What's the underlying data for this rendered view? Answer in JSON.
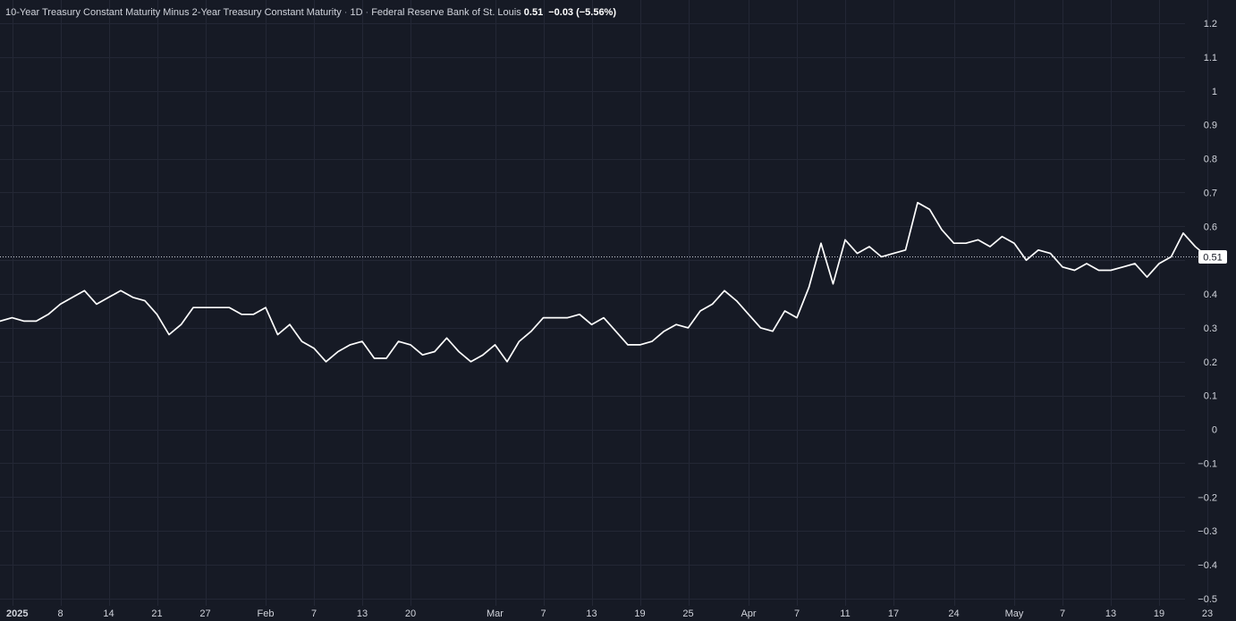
{
  "legend": {
    "title": "10-Year Treasury Constant Maturity Minus 2-Year Treasury Constant Maturity",
    "interval": "1D",
    "source": "Federal Reserve Bank of St. Louis",
    "separator": "·",
    "last_value": "0.51",
    "change": "−0.03",
    "change_percent": "(−5.56%)"
  },
  "colors": {
    "background": "#161a25",
    "grid": "#232735",
    "line": "#ffffff",
    "text": "#d1d4dc",
    "price_tag_bg": "#ffffff",
    "price_tag_text": "#131722"
  },
  "chart_data": {
    "type": "line",
    "series": [
      {
        "values": [
          0.32,
          0.33,
          0.32,
          0.32,
          0.34,
          0.37,
          0.39,
          0.41,
          0.37,
          0.39,
          0.41,
          0.39,
          0.38,
          0.34,
          0.28,
          0.31,
          0.36,
          0.36,
          0.36,
          0.36,
          0.34,
          0.34,
          0.36,
          0.28,
          0.31,
          0.26,
          0.24,
          0.2,
          0.23,
          0.25,
          0.26,
          0.21,
          0.21,
          0.26,
          0.25,
          0.22,
          0.23,
          0.27,
          0.23,
          0.2,
          0.22,
          0.25,
          0.2,
          0.26,
          0.29,
          0.33,
          0.33,
          0.33,
          0.34,
          0.31,
          0.33,
          0.29,
          0.25,
          0.25,
          0.26,
          0.29,
          0.31,
          0.3,
          0.35,
          0.37,
          0.41,
          0.38,
          0.34,
          0.3,
          0.29,
          0.35,
          0.33,
          0.42,
          0.55,
          0.43,
          0.56,
          0.52,
          0.54,
          0.51,
          0.52,
          0.53,
          0.67,
          0.65,
          0.59,
          0.55,
          0.55,
          0.56,
          0.54,
          0.57,
          0.55,
          0.5,
          0.53,
          0.52,
          0.48,
          0.47,
          0.49,
          0.47,
          0.47,
          0.48,
          0.49,
          0.45,
          0.49,
          0.51,
          0.58,
          0.54,
          0.51
        ]
      }
    ],
    "x_tick_labels": [
      {
        "label": "2025",
        "index": 1,
        "bold": true
      },
      {
        "label": "8",
        "index": 5
      },
      {
        "label": "14",
        "index": 9
      },
      {
        "label": "21",
        "index": 13
      },
      {
        "label": "27",
        "index": 17
      },
      {
        "label": "Feb",
        "index": 22
      },
      {
        "label": "7",
        "index": 26
      },
      {
        "label": "13",
        "index": 30
      },
      {
        "label": "20",
        "index": 34
      },
      {
        "label": "Mar",
        "index": 41
      },
      {
        "label": "7",
        "index": 45
      },
      {
        "label": "13",
        "index": 49
      },
      {
        "label": "19",
        "index": 53
      },
      {
        "label": "25",
        "index": 57
      },
      {
        "label": "Apr",
        "index": 62
      },
      {
        "label": "7",
        "index": 66
      },
      {
        "label": "11",
        "index": 70
      },
      {
        "label": "17",
        "index": 74
      },
      {
        "label": "24",
        "index": 79
      },
      {
        "label": "May",
        "index": 84
      },
      {
        "label": "7",
        "index": 88
      },
      {
        "label": "13",
        "index": 92
      },
      {
        "label": "19",
        "index": 96
      },
      {
        "label": "23",
        "index": 100
      }
    ],
    "y_ticks": [
      1.2,
      1.1,
      1,
      0.9,
      0.8,
      0.7,
      0.6,
      0.5,
      0.4,
      0.3,
      0.2,
      0.1,
      0,
      -0.1,
      -0.2,
      -0.3,
      -0.4,
      -0.5
    ],
    "y_tick_labels": [
      "1.2",
      "1.1",
      "1",
      "0.9",
      "0.8",
      "0.7",
      "0.6",
      "0.5",
      "0.4",
      "0.3",
      "0.2",
      "0.1",
      "0",
      "−0.1",
      "−0.2",
      "−0.3",
      "−0.4",
      "−0.5"
    ],
    "hidden_y_tick_labels": [
      "0.5"
    ],
    "ylim": [
      -0.5,
      1.2
    ],
    "last_price": 0.51,
    "last_price_label": "0.51",
    "grid": true,
    "axis_position": "right"
  }
}
